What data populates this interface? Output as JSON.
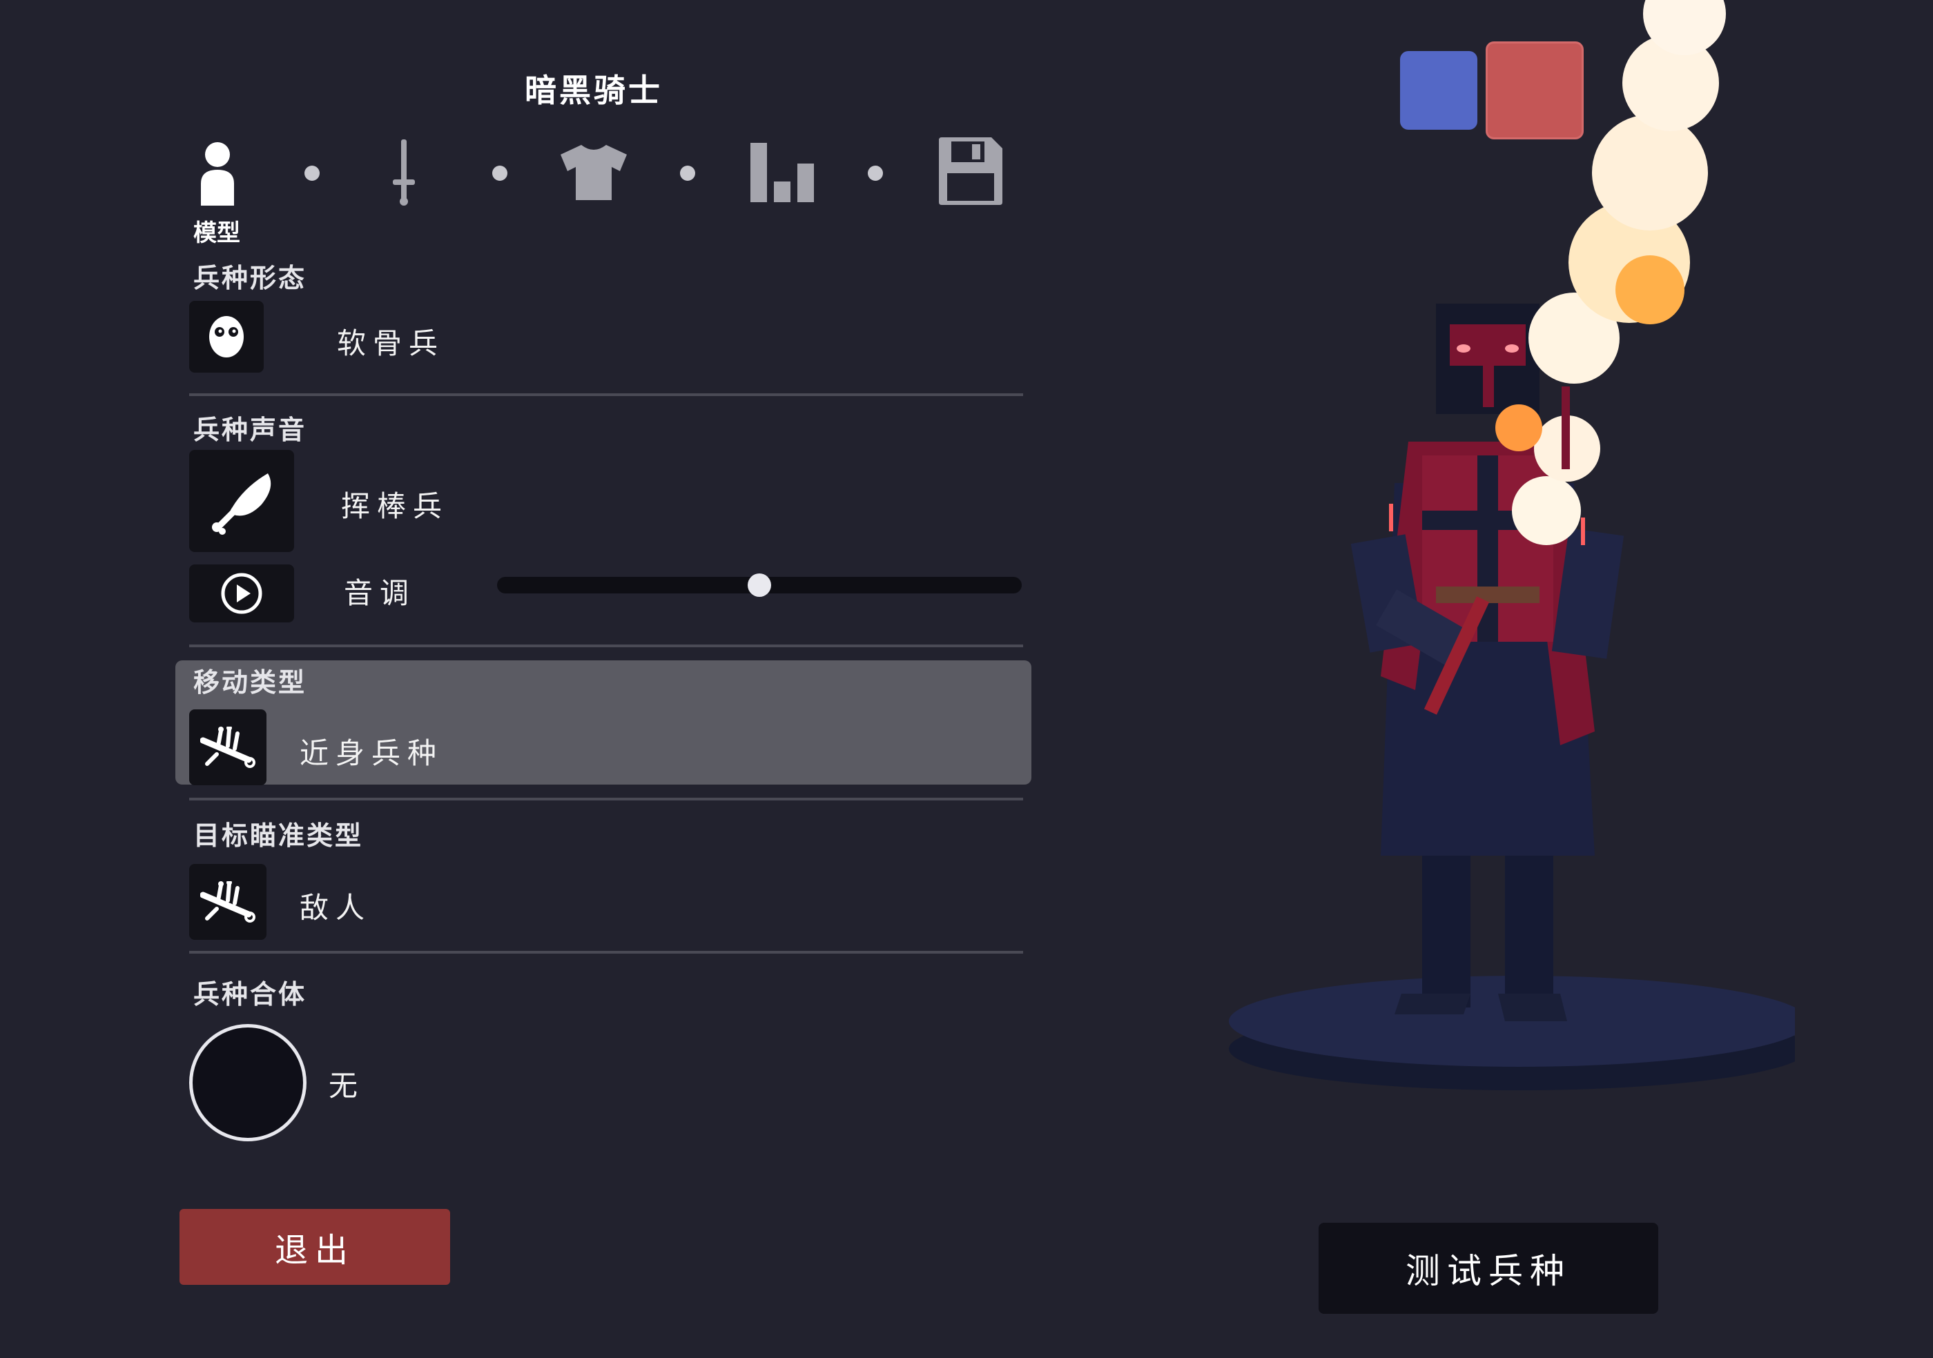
{
  "unit_name": "暗黑骑士",
  "colors": {
    "background": "#22222e",
    "team_blue": "#5468c6",
    "team_red": "#c45656",
    "exit_button": "#8e3434",
    "test_button": "#101018",
    "highlight": "#5b5b63"
  },
  "nav": {
    "steps": [
      {
        "icon": "person-icon",
        "label": "模型",
        "active": true
      },
      {
        "icon": "sword-icon",
        "label": "",
        "active": false
      },
      {
        "icon": "shirt-icon",
        "label": "",
        "active": false
      },
      {
        "icon": "bar-chart-icon",
        "label": "",
        "active": false
      },
      {
        "icon": "save-icon",
        "label": "",
        "active": false
      }
    ]
  },
  "sections": {
    "form": {
      "label": "兵种形态",
      "value": "软骨兵",
      "icon": "face-icon"
    },
    "sound": {
      "label": "兵种声音",
      "value": "挥棒兵",
      "icon": "drumstick-icon",
      "pitch_label": "音调",
      "pitch_icon": "play-icon",
      "pitch_value": 0.5
    },
    "movement": {
      "label": "移动类型",
      "value": "近身兵种",
      "icon": "fallen-unit-icon"
    },
    "targeting": {
      "label": "目标瞄准类型",
      "value": "敌人",
      "icon": "fallen-unit-icon"
    },
    "merge": {
      "label": "兵种合体",
      "value": "无"
    }
  },
  "buttons": {
    "exit": "退出",
    "test": "测试兵种"
  }
}
